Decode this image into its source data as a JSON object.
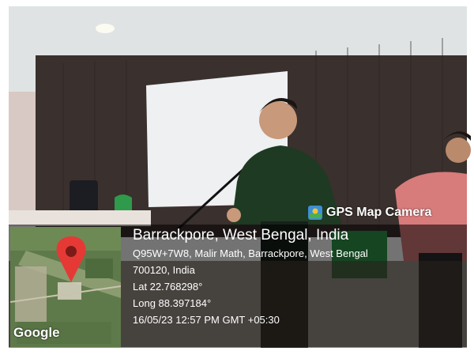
{
  "app": {
    "badge_label": "GPS Map Camera",
    "badge_icon": "gps-map-camera-icon"
  },
  "location": {
    "title": "Barrackpore, West Bengal, India",
    "address_line1": "Q95W+7W8, Malir Math, Barrackpore, West Bengal",
    "address_line2": "700120, India",
    "lat": "Lat 22.768298°",
    "long": "Long 88.397184°",
    "timestamp": "16/05/23 12:57 PM GMT +05:30"
  },
  "map": {
    "provider_label": "Google",
    "pin_icon": "map-pin-icon"
  },
  "colors": {
    "overlay": "#000000",
    "pin": "#e53935",
    "shirt": "#1f3a22",
    "wall": "#3a2f2b",
    "screen": "#eef0f2"
  }
}
